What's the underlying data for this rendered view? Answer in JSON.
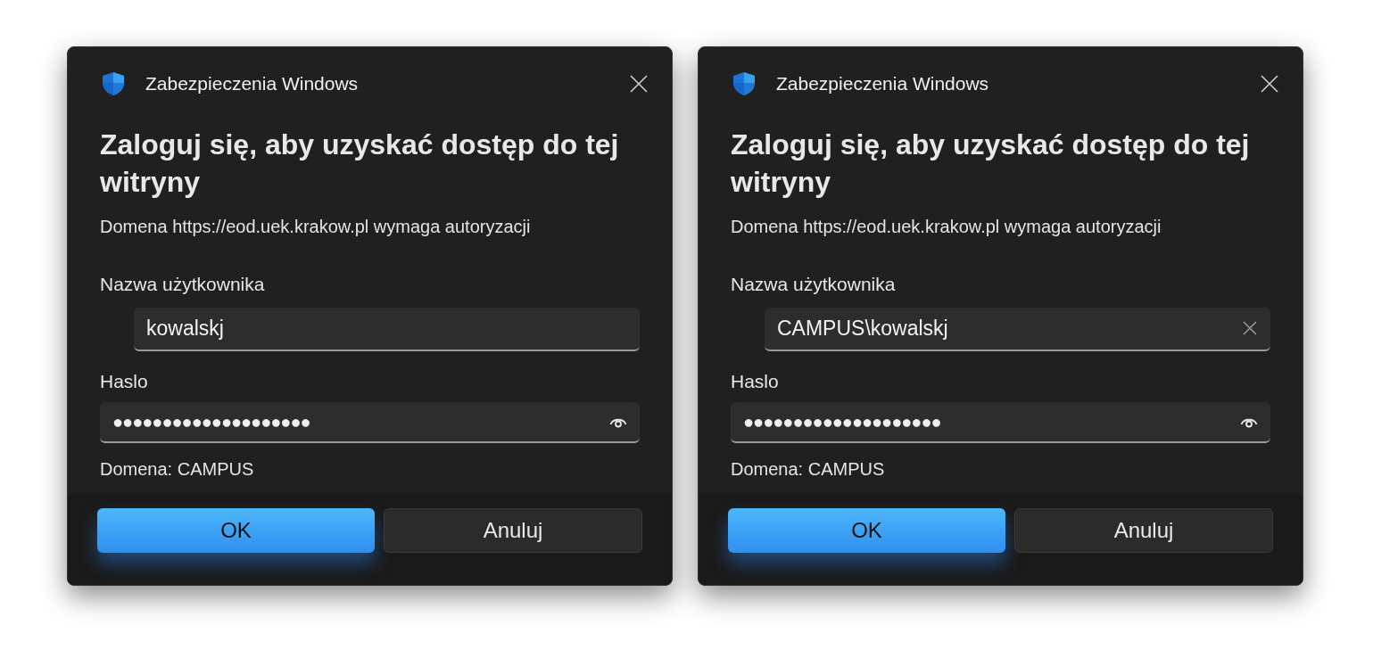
{
  "dialogs": [
    {
      "title": "Zabezpieczenia Windows",
      "heading": "Zaloguj się, aby uzyskać dostęp do tej witryny",
      "message": "Domena https://eod.uek.krakow.pl wymaga autoryzacji",
      "username_label": "Nazwa użytkownika",
      "username": {
        "value": "kowalskj",
        "clear_button": false
      },
      "password_label": "Haslo",
      "password": {
        "value": "●●●●●●●●●●●●●●●●●●●●"
      },
      "domain": "Domena: CAMPUS",
      "buttons": [
        {
          "label": "OK",
          "kind": "primary"
        },
        {
          "label": "Anuluj",
          "kind": "secondary"
        }
      ]
    },
    {
      "title": "Zabezpieczenia Windows",
      "heading": "Zaloguj się, aby uzyskać dostęp do tej witryny",
      "message": "Domena https://eod.uek.krakow.pl wymaga autoryzacji",
      "username_label": "Nazwa użytkownika",
      "username": {
        "value": "CAMPUS\\kowalskj",
        "clear_button": true
      },
      "password_label": "Haslo",
      "password": {
        "value": "●●●●●●●●●●●●●●●●●●●●"
      },
      "domain": "Domena: CAMPUS",
      "buttons": [
        {
          "label": "OK",
          "kind": "primary"
        },
        {
          "label": "Anuluj",
          "kind": "secondary"
        }
      ]
    }
  ]
}
